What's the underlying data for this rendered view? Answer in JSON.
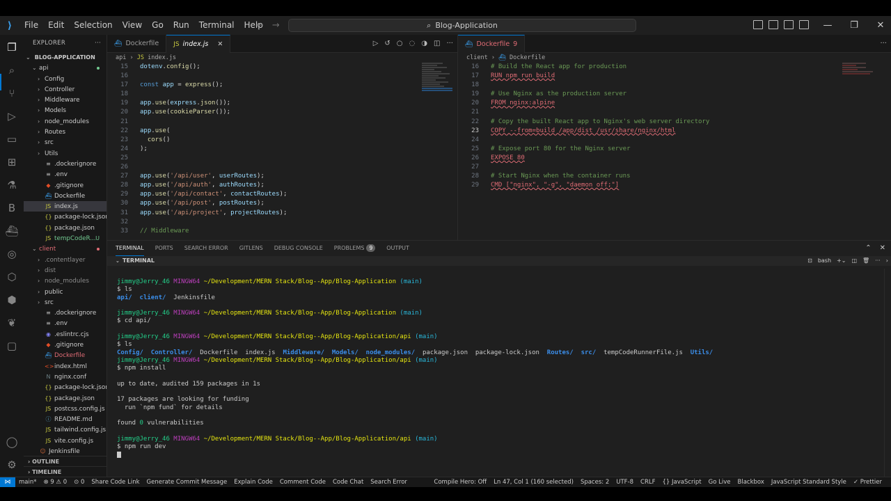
{
  "titlebar": {
    "menu": [
      "File",
      "Edit",
      "Selection",
      "View",
      "Go",
      "Run",
      "Terminal",
      "Help"
    ],
    "search_text": "Blog-Application"
  },
  "sidebar": {
    "title": "EXPLORER",
    "root": "BLOG-APPLICATION",
    "items": [
      {
        "label": "api",
        "kind": "folder-open",
        "indent": 1,
        "status": "dot"
      },
      {
        "label": "Config",
        "kind": "folder",
        "indent": 2
      },
      {
        "label": "Controller",
        "kind": "folder",
        "indent": 2
      },
      {
        "label": "Middleware",
        "kind": "folder",
        "indent": 2
      },
      {
        "label": "Models",
        "kind": "folder",
        "indent": 2
      },
      {
        "label": "node_modules",
        "kind": "folder",
        "indent": 2
      },
      {
        "label": "Routes",
        "kind": "folder",
        "indent": 2
      },
      {
        "label": "src",
        "kind": "folder",
        "indent": 2
      },
      {
        "label": "Utils",
        "kind": "folder",
        "indent": 2
      },
      {
        "label": ".dockerignore",
        "kind": "file-eq",
        "indent": 2
      },
      {
        "label": ".env",
        "kind": "file-eq",
        "indent": 2
      },
      {
        "label": ".gitignore",
        "kind": "file-git",
        "indent": 2
      },
      {
        "label": "Dockerfile",
        "kind": "file-docker",
        "indent": 2
      },
      {
        "label": "index.js",
        "kind": "file-js",
        "indent": 2,
        "selected": true
      },
      {
        "label": "package-lock.json",
        "kind": "file-json",
        "indent": 2
      },
      {
        "label": "package.json",
        "kind": "file-json",
        "indent": 2
      },
      {
        "label": "tempCodeR...",
        "kind": "file-js",
        "indent": 2,
        "status": "U",
        "color": "green"
      },
      {
        "label": "client",
        "kind": "folder-open",
        "indent": 1,
        "color": "red",
        "status": "dotred"
      },
      {
        "label": ".contentlayer",
        "kind": "folder",
        "indent": 2,
        "color": "dim"
      },
      {
        "label": "dist",
        "kind": "folder",
        "indent": 2,
        "color": "dim"
      },
      {
        "label": "node_modules",
        "kind": "folder",
        "indent": 2,
        "color": "dim"
      },
      {
        "label": "public",
        "kind": "folder",
        "indent": 2
      },
      {
        "label": "src",
        "kind": "folder",
        "indent": 2
      },
      {
        "label": ".dockerignore",
        "kind": "file-eq",
        "indent": 2
      },
      {
        "label": ".env",
        "kind": "file-eq",
        "indent": 2
      },
      {
        "label": ".eslintrc.cjs",
        "kind": "file-eslint",
        "indent": 2
      },
      {
        "label": ".gitignore",
        "kind": "file-git",
        "indent": 2
      },
      {
        "label": "Dockerfile",
        "kind": "file-docker",
        "indent": 2,
        "color": "red"
      },
      {
        "label": "index.html",
        "kind": "file-html",
        "indent": 2
      },
      {
        "label": "nginx.conf",
        "kind": "file-nginx",
        "indent": 2
      },
      {
        "label": "package-lock.json",
        "kind": "file-json",
        "indent": 2
      },
      {
        "label": "package.json",
        "kind": "file-json",
        "indent": 2
      },
      {
        "label": "postcss.config.js",
        "kind": "file-js",
        "indent": 2
      },
      {
        "label": "README.md",
        "kind": "file-md",
        "indent": 2
      },
      {
        "label": "tailwind.config.js",
        "kind": "file-js",
        "indent": 2
      },
      {
        "label": "vite.config.js",
        "kind": "file-js",
        "indent": 2
      },
      {
        "label": "Jenkinsfile",
        "kind": "file-jenkins",
        "indent": 1
      }
    ],
    "outline": "OUTLINE",
    "timeline": "TIMELINE"
  },
  "editor_left": {
    "tabs": [
      {
        "label": "Dockerfile",
        "active": false
      },
      {
        "label": "index.js",
        "active": true
      }
    ],
    "breadcrumb": [
      "api",
      "index.js"
    ],
    "lines": [
      {
        "n": "15",
        "html": "<span class=\"v\">dotenv</span><span class=\"t\">.</span><span class=\"f\">config</span><span class=\"t\">();</span>"
      },
      {
        "n": "16",
        "html": ""
      },
      {
        "n": "17",
        "html": "<span class=\"k\">const</span> <span class=\"v\">app</span> <span class=\"t\">=</span> <span class=\"f\">express</span><span class=\"t\">();</span>"
      },
      {
        "n": "18",
        "html": ""
      },
      {
        "n": "19",
        "html": "<span class=\"v\">app</span><span class=\"t\">.</span><span class=\"f\">use</span><span class=\"t\">(</span><span class=\"v\">express</span><span class=\"t\">.</span><span class=\"f\">json</span><span class=\"t\">());</span>"
      },
      {
        "n": "20",
        "html": "<span class=\"v\">app</span><span class=\"t\">.</span><span class=\"f\">use</span><span class=\"t\">(</span><span class=\"f\">cookieParser</span><span class=\"t\">());</span>"
      },
      {
        "n": "21",
        "html": ""
      },
      {
        "n": "22",
        "html": "<span class=\"v\">app</span><span class=\"t\">.</span><span class=\"f\">use</span><span class=\"t\">(</span>"
      },
      {
        "n": "23",
        "html": "  <span class=\"f\">cors</span><span class=\"t\">()</span>"
      },
      {
        "n": "24",
        "html": "<span class=\"t\">);</span>"
      },
      {
        "n": "25",
        "html": ""
      },
      {
        "n": "26",
        "html": ""
      },
      {
        "n": "27",
        "html": "<span class=\"v\">app</span><span class=\"t\">.</span><span class=\"f\">use</span><span class=\"t\">(</span><span class=\"s\">'/api/user'</span><span class=\"t\">, </span><span class=\"v\">userRoutes</span><span class=\"t\">);</span>"
      },
      {
        "n": "28",
        "html": "<span class=\"v\">app</span><span class=\"t\">.</span><span class=\"f\">use</span><span class=\"t\">(</span><span class=\"s\">'/api/auth'</span><span class=\"t\">, </span><span class=\"v\">authRoutes</span><span class=\"t\">);</span>"
      },
      {
        "n": "29",
        "html": "<span class=\"v\">app</span><span class=\"t\">.</span><span class=\"f\">use</span><span class=\"t\">(</span><span class=\"s\">'/api/contact'</span><span class=\"t\">, </span><span class=\"v\">contactRoutes</span><span class=\"t\">);</span>"
      },
      {
        "n": "30",
        "html": "<span class=\"v\">app</span><span class=\"t\">.</span><span class=\"f\">use</span><span class=\"t\">(</span><span class=\"s\">'/api/post'</span><span class=\"t\">, </span><span class=\"v\">postRoutes</span><span class=\"t\">);</span>"
      },
      {
        "n": "31",
        "html": "<span class=\"v\">app</span><span class=\"t\">.</span><span class=\"f\">use</span><span class=\"t\">(</span><span class=\"s\">'/api/project'</span><span class=\"t\">, </span><span class=\"v\">projectRoutes</span><span class=\"t\">);</span>"
      },
      {
        "n": "32",
        "html": ""
      },
      {
        "n": "33",
        "html": "<span class=\"cm\">// Middleware</span>"
      }
    ]
  },
  "editor_right": {
    "tabs": [
      {
        "label": "Dockerfile",
        "badge": "9",
        "active": true
      }
    ],
    "breadcrumb": [
      "client",
      "Dockerfile"
    ],
    "lines": [
      {
        "n": "16",
        "html": "<span class=\"cm\"># Build the React app for production</span>"
      },
      {
        "n": "17",
        "html": "<span class=\"dk\">RUN npm run build</span>"
      },
      {
        "n": "18",
        "html": ""
      },
      {
        "n": "19",
        "html": "<span class=\"cm\"># Use Nginx as the production server</span>"
      },
      {
        "n": "20",
        "html": "<span class=\"dk\">FROM nginx:alpine</span>"
      },
      {
        "n": "21",
        "html": ""
      },
      {
        "n": "22",
        "html": "<span class=\"cm\"># Copy the built React app to Nginx's web server directory</span>"
      },
      {
        "n": "23",
        "html": "<span class=\"dk\">COPY --from=build /app/dist /usr/share/nginx/html</span>",
        "current": true
      },
      {
        "n": "24",
        "html": ""
      },
      {
        "n": "25",
        "html": "<span class=\"cm\"># Expose port 80 for the Nginx server</span>"
      },
      {
        "n": "26",
        "html": "<span class=\"dk\">EXPOSE 80</span>"
      },
      {
        "n": "27",
        "html": ""
      },
      {
        "n": "28",
        "html": "<span class=\"cm\"># Start Nginx when the container runs</span>"
      },
      {
        "n": "29",
        "html": "<span class=\"dk\">CMD [\"nginx\", \"-g\", \"daemon off;\"]</span>"
      }
    ]
  },
  "panel": {
    "tabs": [
      {
        "label": "TERMINAL",
        "active": true
      },
      {
        "label": "PORTS"
      },
      {
        "label": "SEARCH ERROR"
      },
      {
        "label": "GITLENS"
      },
      {
        "label": "DEBUG CONSOLE"
      },
      {
        "label": "PROBLEMS",
        "count": "9"
      },
      {
        "label": "OUTPUT"
      }
    ],
    "terminal_title": "TERMINAL",
    "shell": "bash",
    "lines": [
      {
        "type": "prompt",
        "path": "~/Development/MERN Stack/Blog--App/Blog-Application"
      },
      {
        "type": "cmd",
        "text": "$ ls"
      },
      {
        "type": "html",
        "html": "<span class=\"dir\">api/</span>  <span class=\"dir\">client/</span>  Jenkinsfile"
      },
      {
        "type": "blank"
      },
      {
        "type": "prompt",
        "path": "~/Development/MERN Stack/Blog--App/Blog-Application"
      },
      {
        "type": "cmd",
        "text": "$ cd api/"
      },
      {
        "type": "blank"
      },
      {
        "type": "prompt",
        "path": "~/Development/MERN Stack/Blog--App/Blog-Application/api"
      },
      {
        "type": "cmd",
        "text": "$ ls"
      },
      {
        "type": "html",
        "html": "<span class=\"dir\">Config/</span>  <span class=\"dir\">Controller/</span>  Dockerfile  index.js  <span class=\"dir\">Middleware/</span>  <span class=\"dir\">Models/</span>  <span class=\"dir\">node_modules/</span>  package.json  package-lock.json  <span class=\"dir\">Routes/</span>  <span class=\"dir\">src/</span>  tempCodeRunnerFile.js  <span class=\"dir\">Utils/</span>"
      },
      {
        "type": "prompt",
        "path": "~/Development/MERN Stack/Blog--App/Blog-Application/api"
      },
      {
        "type": "cmd",
        "text": "$ npm install"
      },
      {
        "type": "blank"
      },
      {
        "type": "cmd",
        "text": "up to date, audited 159 packages in 1s"
      },
      {
        "type": "blank"
      },
      {
        "type": "cmd",
        "text": "17 packages are looking for funding"
      },
      {
        "type": "cmd",
        "text": "  run `npm fund` for details"
      },
      {
        "type": "blank"
      },
      {
        "type": "html",
        "html": "found <span class=\"p-user\">0</span> vulnerabilities"
      },
      {
        "type": "blank"
      },
      {
        "type": "prompt",
        "path": "~/Development/MERN Stack/Blog--App/Blog-Application/api"
      },
      {
        "type": "cmd",
        "text": "$ npm run dev"
      },
      {
        "type": "cursor"
      }
    ],
    "prompt_user": "jimmy@Jerry_46",
    "prompt_host": "MINGW64",
    "prompt_branch": "(main)"
  },
  "statusbar": {
    "left": [
      "main*",
      "⊗ 9 ⚠ 0",
      "⊙ 0",
      "Share Code Link",
      "Generate Commit Message",
      "Explain Code",
      "Comment Code",
      "Code Chat",
      "Search Error"
    ],
    "right": [
      "Compile Hero: Off",
      "Ln 47, Col 1 (160 selected)",
      "Spaces: 2",
      "UTF-8",
      "CRLF",
      "{} JavaScript",
      "Go Live",
      "Blackbox",
      "JavaScript Standard Style",
      "✓ Prettier"
    ]
  }
}
